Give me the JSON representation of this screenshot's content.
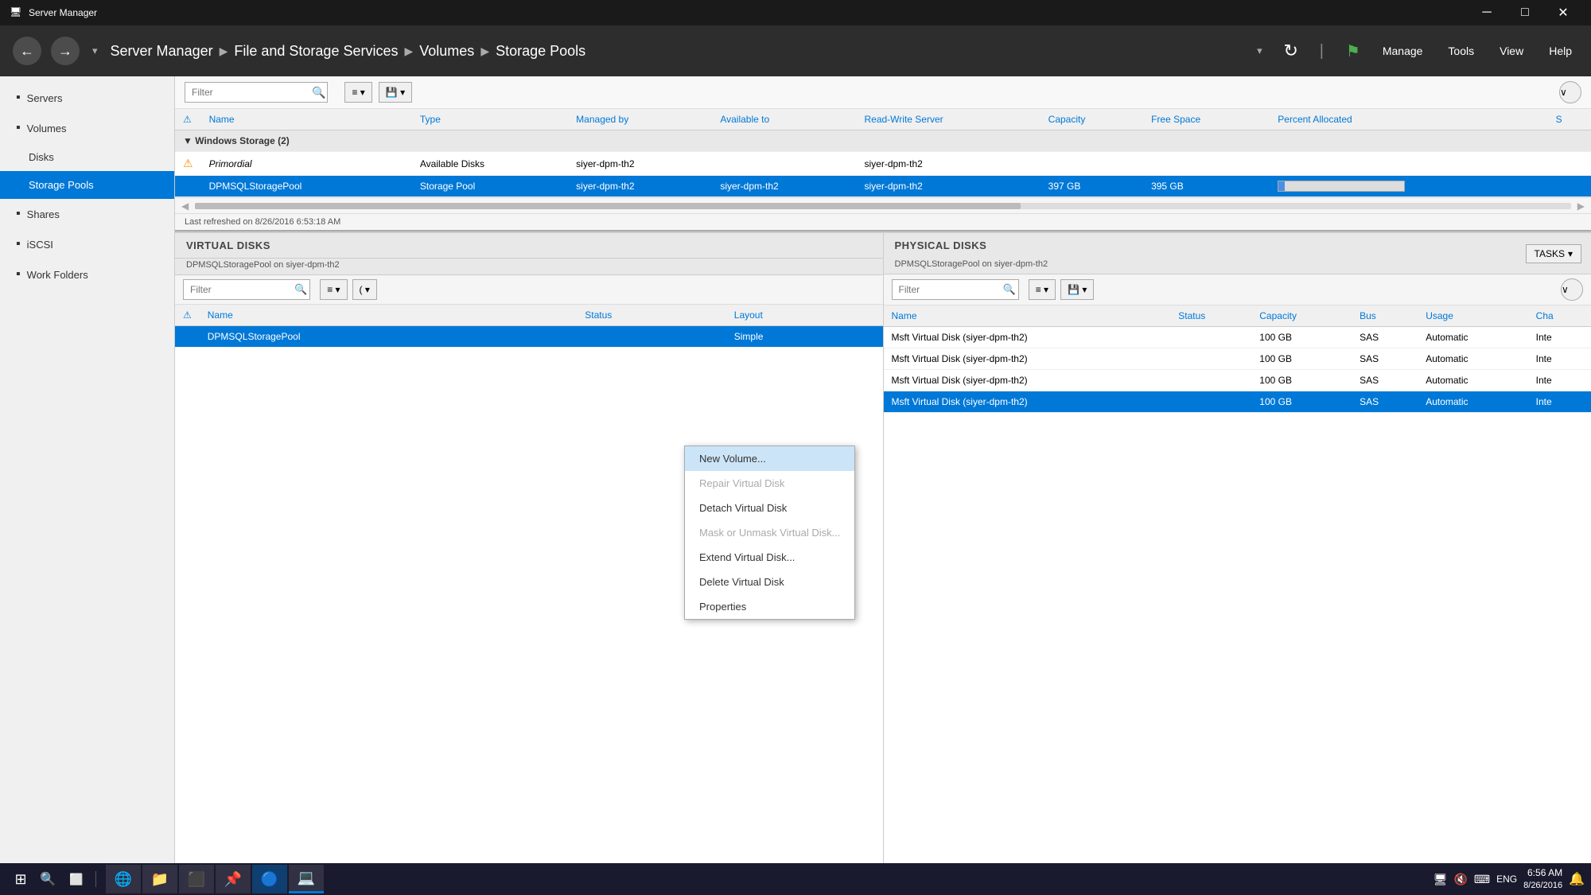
{
  "window": {
    "title": "Server Manager",
    "icon": "🖥"
  },
  "titlebar": {
    "min": "─",
    "max": "□",
    "close": "✕"
  },
  "nav": {
    "back": "←",
    "forward": "→",
    "breadcrumb": [
      "Server Manager",
      "File and Storage Services",
      "Volumes",
      "Storage Pools"
    ],
    "refresh_icon": "↻",
    "flag_icon": "⚑",
    "menu_items": [
      "Manage",
      "Tools",
      "View",
      "Help"
    ]
  },
  "sidebar": {
    "items": [
      {
        "label": "Servers",
        "icon": "▪",
        "level": 0
      },
      {
        "label": "Volumes",
        "icon": "▪",
        "level": 0
      },
      {
        "label": "Disks",
        "icon": "▪",
        "level": 1
      },
      {
        "label": "Storage Pools",
        "icon": "▪",
        "level": 1,
        "active": true
      },
      {
        "label": "Shares",
        "icon": "▪",
        "level": 0
      },
      {
        "label": "iSCSI",
        "icon": "▪",
        "level": 0
      },
      {
        "label": "Work Folders",
        "icon": "▪",
        "level": 0
      }
    ]
  },
  "storage_pools": {
    "filter_placeholder": "Filter",
    "toolbar_icons": [
      "≡",
      "▼",
      "💾",
      "▼"
    ],
    "columns": [
      "Name",
      "Type",
      "Managed by",
      "Available to",
      "Read-Write Server",
      "Capacity",
      "Free Space",
      "Percent Allocated",
      "S"
    ],
    "group_header": "Windows Storage (2)",
    "rows": [
      {
        "name": "Primordial",
        "type": "Available Disks",
        "managed_by": "siyer-dpm-th2",
        "available_to": "",
        "read_write": "siyer-dpm-th2",
        "capacity": "",
        "free_space": "",
        "percent": "",
        "status": "",
        "selected": false
      },
      {
        "name": "DPMSQLStoragePool",
        "type": "Storage Pool",
        "managed_by": "siyer-dpm-th2",
        "available_to": "siyer-dpm-th2",
        "read_write": "siyer-dpm-th2",
        "capacity": "397 GB",
        "free_space": "395 GB",
        "percent": "",
        "status": "",
        "selected": true
      }
    ],
    "last_refreshed": "Last refreshed on 8/26/2016 6:53:18 AM"
  },
  "virtual_disks": {
    "title": "VIRTUAL DISKS",
    "subtitle": "DPMSQLStoragePool on siyer-dpm-th2",
    "filter_placeholder": "Filter",
    "columns": [
      "Name",
      "Status",
      "Layout"
    ],
    "rows": [
      {
        "name": "DPMSQLStoragePool",
        "status": "",
        "layout": "Simple",
        "selected": true
      }
    ]
  },
  "physical_disks": {
    "title": "PHYSICAL DISKS",
    "subtitle": "DPMSQLStoragePool on siyer-dpm-th2",
    "tasks_label": "TASKS",
    "filter_placeholder": "Filter",
    "columns": [
      "Name",
      "Status",
      "Capacity",
      "Bus",
      "Usage",
      "Cha"
    ],
    "rows": [
      {
        "name": "Msft Virtual Disk (siyer-dpm-th2)",
        "status": "",
        "capacity": "100 GB",
        "bus": "SAS",
        "usage": "Automatic",
        "cha": "Inte",
        "selected": false
      },
      {
        "name": "Msft Virtual Disk (siyer-dpm-th2)",
        "status": "",
        "capacity": "100 GB",
        "bus": "SAS",
        "usage": "Automatic",
        "cha": "Inte",
        "selected": false
      },
      {
        "name": "Msft Virtual Disk (siyer-dpm-th2)",
        "status": "",
        "capacity": "100 GB",
        "bus": "SAS",
        "usage": "Automatic",
        "cha": "Inte",
        "selected": false
      },
      {
        "name": "Msft Virtual Disk (siyer-dpm-th2)",
        "status": "",
        "capacity": "100 GB",
        "bus": "SAS",
        "usage": "Automatic",
        "cha": "Inte",
        "selected": true
      }
    ]
  },
  "context_menu": {
    "items": [
      {
        "label": "New Volume...",
        "active": true,
        "disabled": false
      },
      {
        "label": "Repair Virtual Disk",
        "active": false,
        "disabled": true
      },
      {
        "label": "Detach Virtual Disk",
        "active": false,
        "disabled": false
      },
      {
        "label": "Mask or Unmask Virtual Disk...",
        "active": false,
        "disabled": true
      },
      {
        "label": "Extend Virtual Disk...",
        "active": false,
        "disabled": false
      },
      {
        "label": "Delete Virtual Disk",
        "active": false,
        "disabled": false
      },
      {
        "label": "Properties",
        "active": false,
        "disabled": false
      }
    ]
  },
  "taskbar": {
    "start_icon": "⊞",
    "search_icon": "🔍",
    "task_view_icon": "⬜",
    "apps": [
      {
        "icon": "🌐",
        "label": "IE"
      },
      {
        "icon": "📁",
        "label": "Explorer"
      },
      {
        "icon": "⬛",
        "label": "CMD"
      },
      {
        "icon": "📌",
        "label": "Pinned"
      },
      {
        "icon": "🔵",
        "label": "App1"
      },
      {
        "icon": "💻",
        "label": "ServerMgr",
        "active": true
      }
    ],
    "sys_icons": [
      "🔇",
      "🔑",
      "⌨"
    ],
    "lang": "ENG",
    "time": "6:56 AM",
    "date": "8/26/2016",
    "notification": "🔔"
  },
  "colors": {
    "accent": "#0078d7",
    "selected_row": "#0078d7",
    "header_bg": "#2d2d2d",
    "sidebar_active": "#0078d7",
    "context_active": "#cce4f7",
    "progress_bar": "#4a90e2"
  }
}
